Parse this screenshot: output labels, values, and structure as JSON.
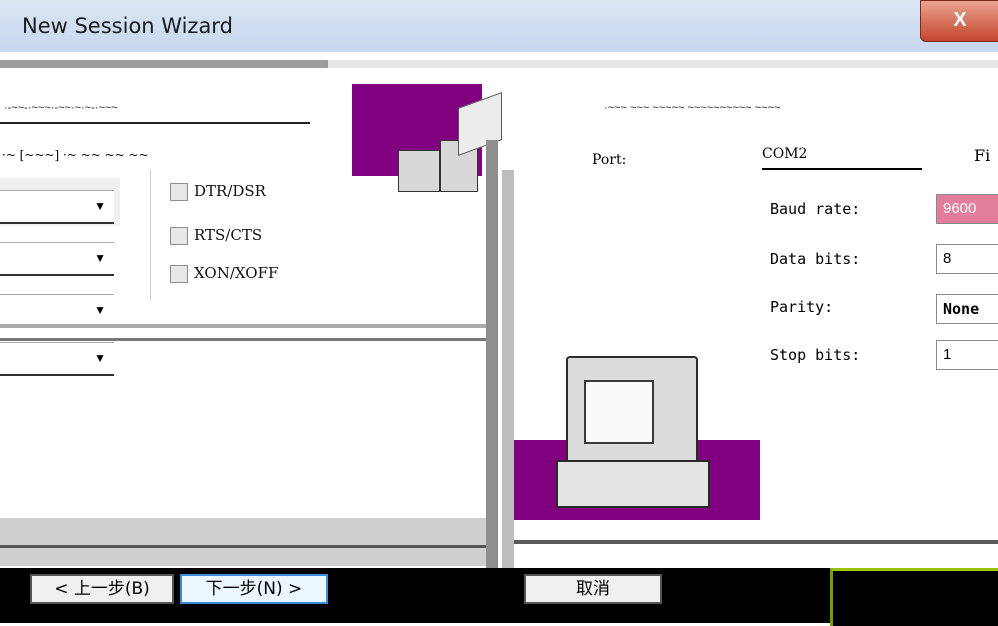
{
  "window": {
    "title": "New Session Wizard",
    "close_label": "X"
  },
  "left_pane": {
    "garbled_heading": "·-~~-·~~~·-~~·~·~-·~~~",
    "garbled_label": "·~ [~~~] ·~ ~~ ~~ ~~",
    "flow_control": {
      "dtr_dsr": "DTR/DSR",
      "rts_cts": "RTS/CTS",
      "xon_xoff": "XON/XOFF"
    }
  },
  "right_pane": {
    "garbled_instructions": "·~~~ ~~~ ~~~~~ ~~~~~~~~~~ ~~~~",
    "port_label": "Port:",
    "port_value": "COM2",
    "fi_label": "Fi",
    "baud_rate_label": "Baud rate:",
    "baud_rate_value": "9600",
    "data_bits_label": "Data bits:",
    "data_bits_value": "8",
    "parity_label": "Parity:",
    "parity_value": "None",
    "stop_bits_label": "Stop bits:",
    "stop_bits_value": "1"
  },
  "footer": {
    "back_label": "< 上一步(B)",
    "next_label": "下一步(N) >",
    "cancel_label": "取消"
  },
  "colors": {
    "purple": "#800080",
    "selection_pink": "#e27d9c",
    "close_red": "#c4452c"
  }
}
